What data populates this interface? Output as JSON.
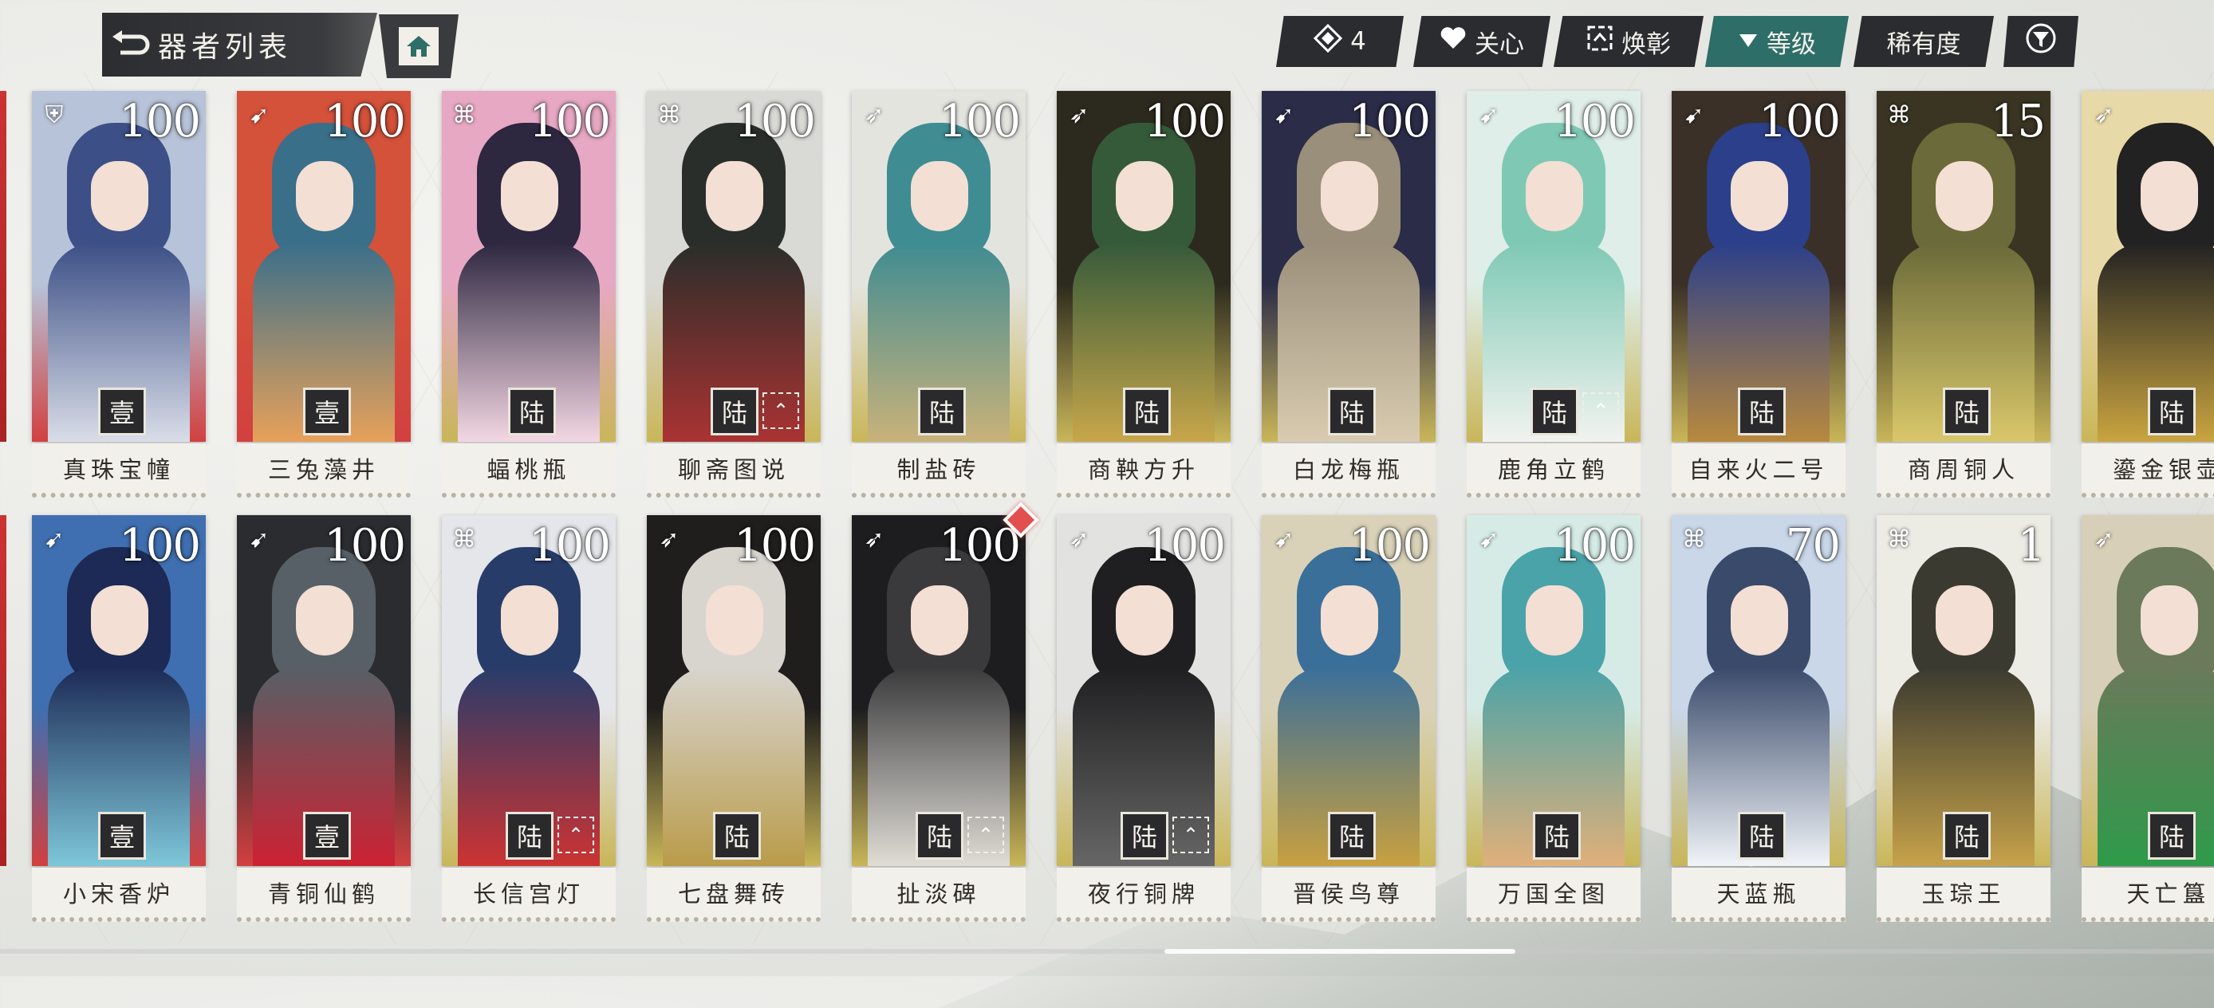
{
  "header": {
    "title": "器者列表",
    "back_icon": "back-arrow-icon",
    "home_icon": "home-icon"
  },
  "toolbar": {
    "filter_count_icon": "diamond-filter-icon",
    "filter_count": "4",
    "favorite_label": "关心",
    "favorite_icon": "heart-icon",
    "awaken_label": "焕彰",
    "awaken_icon": "awaken-icon",
    "level_label": "等级",
    "level_icon": "sort-down-icon",
    "rarity_label": "稀有度",
    "filter_icon": "funnel-icon",
    "active_color": "#2e6e68"
  },
  "rows": [
    [
      {
        "name": "真珠宝幢",
        "rank": "100",
        "grade": "壹",
        "class": "shield",
        "awakened": false,
        "palette": [
          "#b7c3d8",
          "#3c4f86",
          "#d9dde8"
        ]
      },
      {
        "name": "三兔藻井",
        "rank": "100",
        "grade": "壹",
        "class": "bow",
        "awakened": false,
        "palette": [
          "#d4513a",
          "#3a6f8a",
          "#e7a15a"
        ]
      },
      {
        "name": "蝠桃瓶",
        "rank": "100",
        "grade": "陆",
        "class": "knot",
        "awakened": false,
        "palette": [
          "#e7a8c3",
          "#2d2740",
          "#f4d7e3"
        ]
      },
      {
        "name": "聊斋图说",
        "rank": "100",
        "grade": "陆",
        "class": "knot",
        "awakened": true,
        "palette": [
          "#d9dad6",
          "#2a2e2a",
          "#a33"
        ]
      },
      {
        "name": "制盐砖",
        "rank": "100",
        "grade": "陆",
        "class": "spear",
        "awakened": false,
        "palette": [
          "#e4e4df",
          "#3f8c92",
          "#c9b27a"
        ]
      },
      {
        "name": "商鞅方升",
        "rank": "100",
        "grade": "陆",
        "class": "spear",
        "awakened": false,
        "palette": [
          "#2c2a1e",
          "#355a3a",
          "#c8a64a"
        ]
      },
      {
        "name": "白龙梅瓶",
        "rank": "100",
        "grade": "陆",
        "class": "bow",
        "awakened": false,
        "palette": [
          "#2b2c48",
          "#9a8f7a",
          "#d8cbb0"
        ]
      },
      {
        "name": "鹿角立鹤",
        "rank": "100",
        "grade": "陆",
        "class": "bow",
        "awakened": true,
        "palette": [
          "#dfeee8",
          "#7fc9b4",
          "#f1f3f0"
        ]
      },
      {
        "name": "自来火二号",
        "rank": "100",
        "grade": "陆",
        "class": "bow",
        "awakened": false,
        "palette": [
          "#3a3028",
          "#2b3f8a",
          "#b8893e"
        ]
      },
      {
        "name": "商周铜人",
        "rank": "15",
        "grade": "陆",
        "class": "knot",
        "awakened": false,
        "palette": [
          "#3a3522",
          "#6a6a3a",
          "#d9c76a"
        ]
      },
      {
        "name": "鎏金银壶",
        "rank": "",
        "grade": "陆",
        "class": "spear",
        "awakened": false,
        "palette": [
          "#e8d9a8",
          "#222",
          "#c9a440"
        ]
      }
    ],
    [
      {
        "name": "小宋香炉",
        "rank": "100",
        "grade": "壹",
        "class": "bow",
        "awakened": false,
        "palette": [
          "#3f6fb1",
          "#1c2a55",
          "#7ec7d9"
        ]
      },
      {
        "name": "青铜仙鹤",
        "rank": "100",
        "grade": "壹",
        "class": "bow",
        "awakened": false,
        "palette": [
          "#2a2c30",
          "#566066",
          "#c23"
        ]
      },
      {
        "name": "长信宫灯",
        "rank": "100",
        "grade": "陆",
        "class": "knot",
        "awakened": true,
        "palette": [
          "#e4e6ea",
          "#283c6a",
          "#c33"
        ]
      },
      {
        "name": "七盘舞砖",
        "rank": "100",
        "grade": "陆",
        "class": "spear",
        "awakened": false,
        "palette": [
          "#1f1e1c",
          "#d8d5cf",
          "#b99b4a"
        ]
      },
      {
        "name": "扯淡碑",
        "rank": "100",
        "grade": "陆",
        "class": "spear",
        "awakened": true,
        "palette": [
          "#1d1d1f",
          "#3a3a3c",
          "#e0ddd6"
        ]
      },
      {
        "name": "夜行铜牌",
        "rank": "100",
        "grade": "陆",
        "class": "spear",
        "awakened": true,
        "palette": [
          "#e2e2e0",
          "#1f1f21",
          "#666"
        ]
      },
      {
        "name": "晋侯鸟尊",
        "rank": "100",
        "grade": "陆",
        "class": "bow",
        "awakened": false,
        "palette": [
          "#d9d2b8",
          "#3a6f9a",
          "#c8a040"
        ]
      },
      {
        "name": "万国全图",
        "rank": "100",
        "grade": "陆",
        "class": "bow",
        "awakened": false,
        "palette": [
          "#d6ebe6",
          "#4aa3a8",
          "#e0b07a"
        ]
      },
      {
        "name": "天蓝瓶",
        "rank": "70",
        "grade": "陆",
        "class": "knot",
        "awakened": false,
        "palette": [
          "#c9d7e9",
          "#3a4a6a",
          "#f0f4f8"
        ]
      },
      {
        "name": "玉琮王",
        "rank": "1",
        "grade": "陆",
        "class": "knot",
        "awakened": false,
        "palette": [
          "#ecebe4",
          "#3a3a30",
          "#c6a24a"
        ]
      },
      {
        "name": "天亡簋",
        "rank": "",
        "grade": "陆",
        "class": "spear",
        "awakened": false,
        "palette": [
          "#d8cfb8",
          "#6a7a5a",
          "#2e9a4a"
        ]
      }
    ]
  ],
  "class_glyphs": {
    "shield": "⛨",
    "bow": "➹",
    "knot": "⌘",
    "spear": "➶"
  },
  "notification_on": "扯淡碑"
}
